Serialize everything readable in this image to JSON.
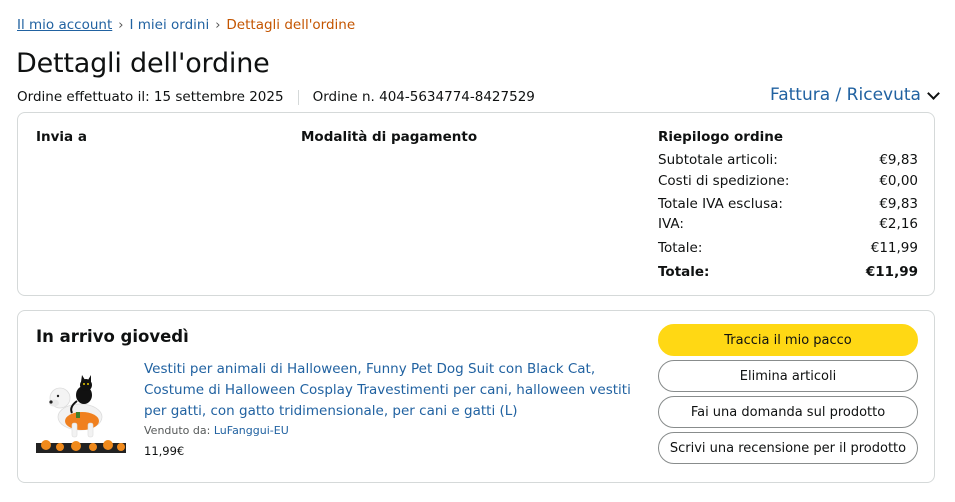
{
  "breadcrumb": {
    "home": "Il mio account",
    "orders": "I miei ordini",
    "current": "Dettagli dell'ordine",
    "separator": "›"
  },
  "page_title": "Dettagli dell'ordine",
  "order_meta": {
    "placed": "Ordine effettuato il: 15 settembre 2025",
    "number": "Ordine n. 404-5634774-8427529"
  },
  "invoice_link": "Fattura / Ricevuta",
  "details": {
    "ship_to": "Invia a",
    "payment": "Modalità di pagamento",
    "summary_title": "Riepilogo ordine",
    "summary": [
      {
        "label": "Subtotale articoli:",
        "value": "€9,83"
      },
      {
        "label": "Costi di spedizione:",
        "value": "€0,00"
      },
      {
        "label": "Totale IVA esclusa:",
        "value": "€9,83"
      },
      {
        "label": "IVA:",
        "value": "€2,16"
      },
      {
        "label": "Totale:",
        "value": "€11,99"
      },
      {
        "label": "Totale:",
        "value": "€11,99"
      }
    ]
  },
  "shipment": {
    "arrival": "In arrivo giovedì",
    "product_title": "Vestiti per animali di Halloween, Funny Pet Dog Suit con Black Cat, Costume di Halloween Cosplay Travestimenti per cani, halloween vestiti per gatti, con gatto tridimensionale, per cani e gatti (L)",
    "sold_by_label": "Venduto da:",
    "seller": "LuFanggui-EU",
    "price": "11,99€",
    "buttons": {
      "track": "Traccia il mio pacco",
      "delete": "Elimina articoli",
      "question": "Fai una domanda sul prodotto",
      "review": "Scrivi una recensione per il prodotto"
    }
  },
  "colors": {
    "link": "#2162a1",
    "current_crumb": "#c45500",
    "primary_button": "#ffd814",
    "border": "#d5d9d9"
  }
}
